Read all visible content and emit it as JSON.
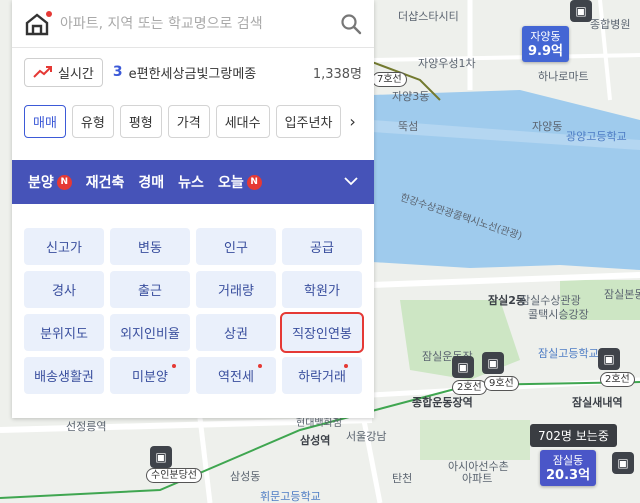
{
  "search": {
    "placeholder": "아파트, 지역 또는 학교명으로 검색"
  },
  "realtime": {
    "label": "실시간",
    "rank": "3",
    "text": "e편한세상금빛그랑메종",
    "count": "1,338명"
  },
  "filters": [
    {
      "label": "매매",
      "active": true
    },
    {
      "label": "유형",
      "active": false
    },
    {
      "label": "평형",
      "active": false
    },
    {
      "label": "가격",
      "active": false
    },
    {
      "label": "세대수",
      "active": false
    },
    {
      "label": "입주년차",
      "active": false
    }
  ],
  "nav": [
    {
      "label": "분양",
      "badge": "N"
    },
    {
      "label": "재건축",
      "badge": ""
    },
    {
      "label": "경매",
      "badge": ""
    },
    {
      "label": "뉴스",
      "badge": ""
    },
    {
      "label": "오늘",
      "badge": "N"
    }
  ],
  "grid": [
    {
      "label": "신고가",
      "dot": false,
      "selected": false
    },
    {
      "label": "변동",
      "dot": false,
      "selected": false
    },
    {
      "label": "인구",
      "dot": false,
      "selected": false
    },
    {
      "label": "공급",
      "dot": false,
      "selected": false
    },
    {
      "label": "경사",
      "dot": false,
      "selected": false
    },
    {
      "label": "출근",
      "dot": false,
      "selected": false
    },
    {
      "label": "거래량",
      "dot": false,
      "selected": false
    },
    {
      "label": "학원가",
      "dot": false,
      "selected": false
    },
    {
      "label": "분위지도",
      "dot": false,
      "selected": false
    },
    {
      "label": "외지인비율",
      "dot": false,
      "selected": false
    },
    {
      "label": "상권",
      "dot": false,
      "selected": false
    },
    {
      "label": "직장인연봉",
      "dot": false,
      "selected": true
    },
    {
      "label": "배송생활권",
      "dot": false,
      "selected": false
    },
    {
      "label": "미분양",
      "dot": true,
      "selected": false
    },
    {
      "label": "역전세",
      "dot": true,
      "selected": false
    },
    {
      "label": "하락거래",
      "dot": true,
      "selected": false
    }
  ],
  "map": {
    "labels": [
      "더샵스타시티",
      "종합병원",
      "자양우성1차",
      "자양3동",
      "하나로마트",
      "뚝섬",
      "자양동",
      "광양고등학교",
      "한강수상관광콜택시노선(관광)",
      "잠실2동",
      "잠실수상관광",
      "콜택시승강장",
      "잠실본동",
      "잠실고등학교",
      "잠실운동장",
      "종합운동장역",
      "잠실새내역",
      "선정릉역",
      "삼성역",
      "현대백화점",
      "서울강남",
      "삼성동",
      "아시아선수촌",
      "아파트",
      "휘문고등학교",
      "수인분당선",
      "탄천",
      "자양3동"
    ],
    "pins": [
      {
        "name": "자양동",
        "price": "9.9억"
      },
      {
        "name": "잠실동",
        "price": "20.3억"
      }
    ],
    "viewers": "702명 보는중",
    "lines": [
      "7호선",
      "2호선",
      "9호선",
      "2호선",
      "수인분당선"
    ]
  }
}
